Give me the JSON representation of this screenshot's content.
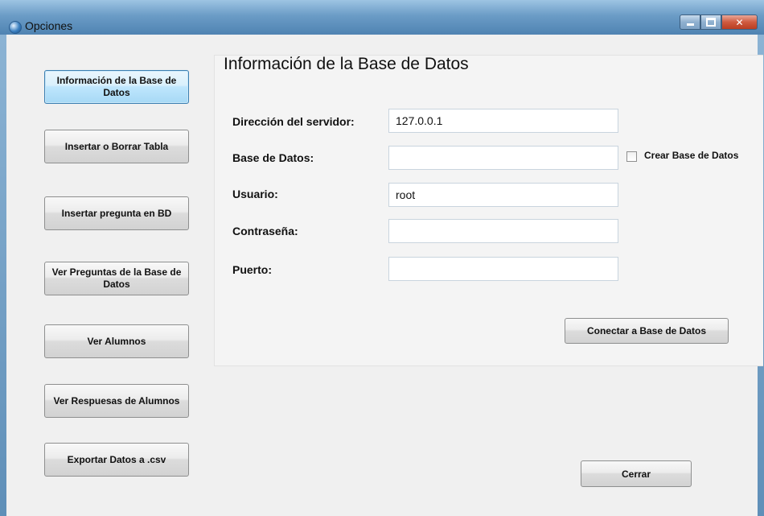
{
  "window": {
    "title": "Opciones",
    "controls": {
      "minimize_icon": "minimize-icon",
      "maximize_icon": "maximize-icon",
      "close_icon": "close-icon"
    }
  },
  "sidebar": {
    "items": [
      {
        "label": "Información de la Base de Datos",
        "active": true
      },
      {
        "label": "Insertar o Borrar Tabla",
        "active": false
      },
      {
        "label": "Insertar pregunta en BD",
        "active": false
      },
      {
        "label": "Ver Preguntas de la Base de Datos",
        "active": false
      },
      {
        "label": "Ver Alumnos",
        "active": false
      },
      {
        "label": "Ver Respuesas de Alumnos",
        "active": false
      },
      {
        "label": "Exportar Datos a .csv",
        "active": false
      }
    ]
  },
  "panel": {
    "title": "Información de la Base de Datos",
    "fields": {
      "server": {
        "label": "Dirección del servidor:",
        "value": "127.0.0.1"
      },
      "database": {
        "label": "Base de Datos:",
        "value": ""
      },
      "user": {
        "label": "Usuario:",
        "value": "root"
      },
      "password": {
        "label": "Contraseña:",
        "value": ""
      },
      "port": {
        "label": "Puerto:",
        "value": ""
      }
    },
    "create_db_checkbox": {
      "label": "Crear Base de Datos",
      "checked": false
    },
    "connect_button": "Conectar a Base de Datos"
  },
  "close_button": "Cerrar",
  "colors": {
    "active_button_border": "#3c7fb1",
    "panel_background": "#f4f4f4",
    "client_background": "#f0f0f0"
  }
}
